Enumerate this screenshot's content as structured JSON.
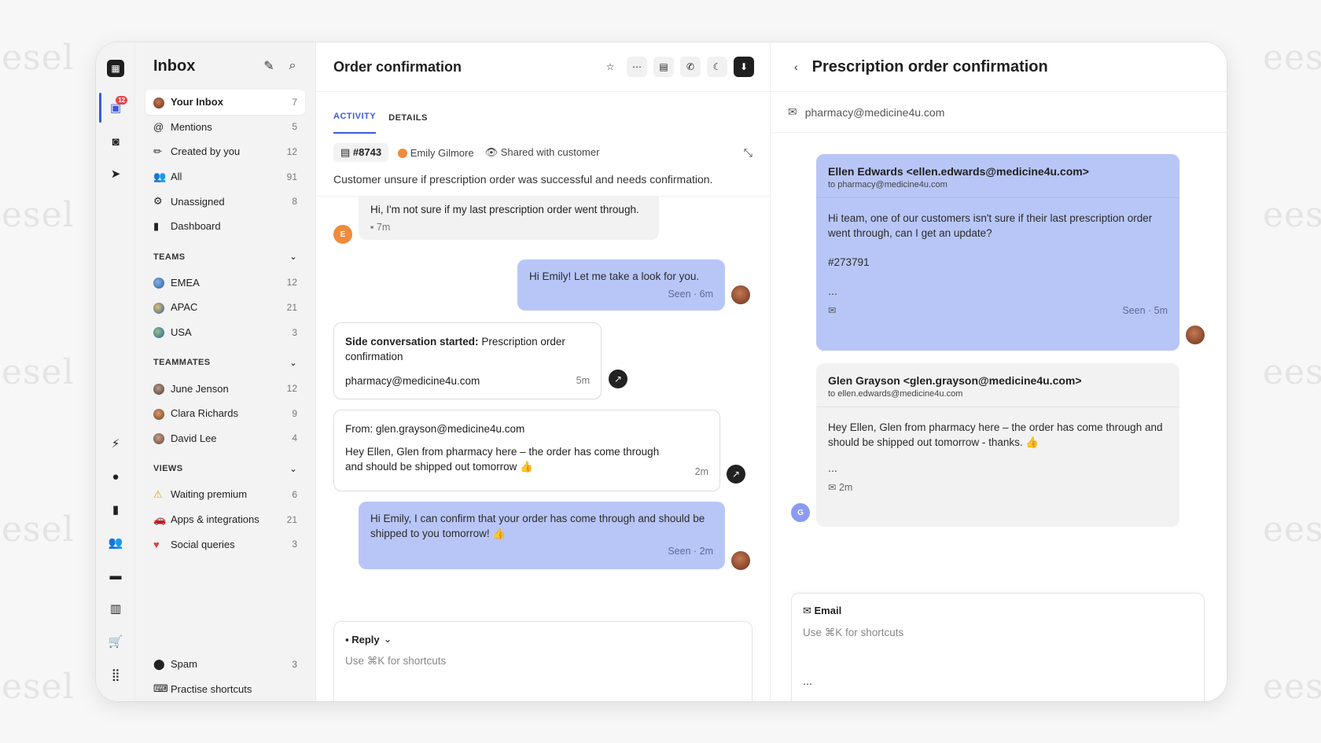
{
  "watermarks": [
    "esel",
    "esel",
    "esel",
    "esel",
    "esel",
    "eese",
    "eese",
    "eese",
    "eese",
    "eese"
  ],
  "rail": {
    "inbox_badge": "12"
  },
  "sidebar": {
    "title": "Inbox",
    "items": [
      {
        "label": "Your Inbox",
        "count": "7"
      },
      {
        "label": "Mentions",
        "count": "5"
      },
      {
        "label": "Created by you",
        "count": "12"
      },
      {
        "label": "All",
        "count": "91"
      },
      {
        "label": "Unassigned",
        "count": "8"
      },
      {
        "label": "Dashboard",
        "count": ""
      }
    ],
    "teams_label": "TEAMS",
    "teams": [
      {
        "label": "EMEA",
        "count": "12"
      },
      {
        "label": "APAC",
        "count": "21"
      },
      {
        "label": "USA",
        "count": "3"
      }
    ],
    "teammates_label": "TEAMMATES",
    "teammates": [
      {
        "label": "June Jenson",
        "count": "12"
      },
      {
        "label": "Clara Richards",
        "count": "9"
      },
      {
        "label": "David Lee",
        "count": "4"
      }
    ],
    "views_label": "VIEWS",
    "views": [
      {
        "label": "Waiting premium",
        "count": "6"
      },
      {
        "label": "Apps & integrations",
        "count": "21"
      },
      {
        "label": "Social queries",
        "count": "3"
      }
    ],
    "bottom": [
      {
        "label": "Spam",
        "count": "3"
      },
      {
        "label": "Practise shortcuts",
        "count": ""
      }
    ]
  },
  "conversation": {
    "title": "Order confirmation",
    "tabs": [
      "ACTIVITY",
      "DETAILS"
    ],
    "ticket": "#8743",
    "customer": "Emily Gilmore",
    "shared": "Shared with customer",
    "summary": "Customer unsure if prescription order was successful and needs confirmation.",
    "emily_avatar": "E",
    "messages": {
      "m1_text": "Hi, I'm not sure if my last prescription order went through.",
      "m1_time": "7m",
      "m2_text": "Hi Emily! Let me take a look for you.",
      "m2_seen": "Seen · 6m",
      "side_bold": "Side conversation started:",
      "side_rest": " Prescription order confirmation",
      "side_email": "pharmacy@medicine4u.com",
      "side_time": "5m",
      "from_line": "From: glen.grayson@medicine4u.com",
      "from_body": "Hey Ellen, Glen from pharmacy here – the order has come through and should be shipped out tomorrow 👍",
      "from_time": "2m",
      "m4_text": "Hi Emily, I can confirm that your order has come through and should be shipped to you tomorrow! 👍",
      "m4_seen": "Seen · 2m"
    },
    "composer": {
      "mode": "Reply",
      "placeholder": "Use ⌘K for shortcuts"
    }
  },
  "panel": {
    "title": "Prescription order confirmation",
    "mailbox": "pharmacy@medicine4u.com",
    "email1": {
      "from": "Ellen Edwards <ellen.edwards@medicine4u.com>",
      "to": "to pharmacy@medicine4u.com",
      "body": "Hi team, one of our customers isn't sure if their last prescription order went through, can I get an update?",
      "ref": "#273791",
      "seen": "Seen · 5m"
    },
    "email2": {
      "from": "Glen Grayson <glen.grayson@medicine4u.com>",
      "to": "to ellen.edwards@medicine4u.com",
      "body": "Hey Ellen, Glen from pharmacy here – the order has come through and should be shipped out tomorrow - thanks. 👍",
      "time": "2m",
      "avatar": "G"
    },
    "composer": {
      "mode": "Email",
      "placeholder": "Use ⌘K for shortcuts"
    }
  },
  "colors": {
    "accent": "#3b5bdb",
    "outgoing_bubble": "#b8c6f7",
    "incoming_bubble": "#f2f2f2"
  }
}
